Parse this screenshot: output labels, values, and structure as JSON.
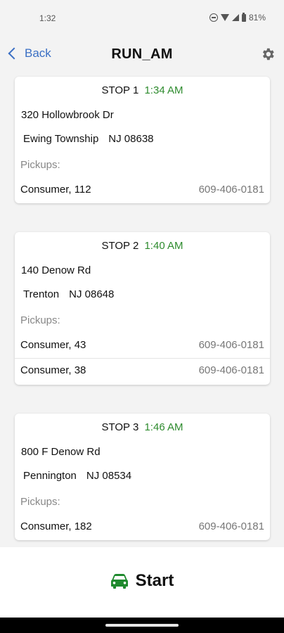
{
  "status_bar": {
    "time": "1:32",
    "battery": "81%"
  },
  "header": {
    "back_label": "Back",
    "title": "RUN_AM"
  },
  "stops": [
    {
      "label": "STOP 1",
      "time": "1:34 AM",
      "street": "320 Hollowbrook Dr",
      "city": "Ewing Township",
      "state_zip": "NJ 08638",
      "pickups_label": "Pickups:",
      "pickups": [
        {
          "name": "Consumer, 112",
          "phone": "609-406-0181"
        }
      ]
    },
    {
      "label": "STOP 2",
      "time": "1:40 AM",
      "street": "140 Denow Rd",
      "city": "Trenton",
      "state_zip": "NJ 08648",
      "pickups_label": "Pickups:",
      "pickups": [
        {
          "name": "Consumer, 43",
          "phone": "609-406-0181"
        },
        {
          "name": "Consumer, 38",
          "phone": "609-406-0181"
        }
      ]
    },
    {
      "label": "STOP 3",
      "time": "1:46 AM",
      "street": "800 F Denow Rd",
      "city": "Pennington",
      "state_zip": "NJ 08534",
      "pickups_label": "Pickups:",
      "pickups": [
        {
          "name": "Consumer, 182",
          "phone": "609-406-0181"
        }
      ]
    }
  ],
  "bottom": {
    "start_label": "Start",
    "icon": "car-icon"
  },
  "colors": {
    "accent_blue": "#3a6fc4",
    "time_green": "#2e8b2e",
    "car_green": "#1f8a2e"
  }
}
